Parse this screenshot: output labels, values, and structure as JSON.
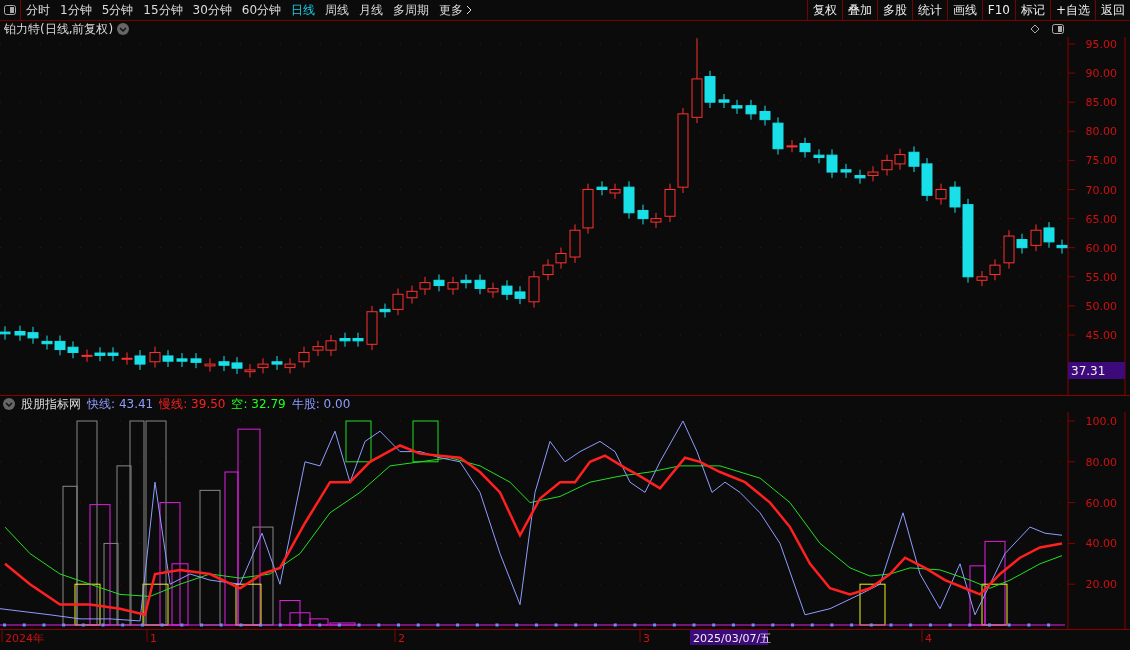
{
  "toolbar": {
    "periods": [
      {
        "label": "分时",
        "selected": false
      },
      {
        "label": "1分钟",
        "selected": false
      },
      {
        "label": "5分钟",
        "selected": false
      },
      {
        "label": "15分钟",
        "selected": false
      },
      {
        "label": "30分钟",
        "selected": false
      },
      {
        "label": "60分钟",
        "selected": false
      },
      {
        "label": "日线",
        "selected": true
      },
      {
        "label": "周线",
        "selected": false
      },
      {
        "label": "月线",
        "selected": false
      },
      {
        "label": "多周期",
        "selected": false
      },
      {
        "label": "更多",
        "selected": false
      }
    ],
    "actions": [
      "复权",
      "叠加",
      "多股",
      "统计",
      "画线",
      "F10",
      "标记",
      "+自选",
      "返回"
    ]
  },
  "main_chart": {
    "title": "铂力特(日线,前复权)",
    "price_ticks": [
      "95.00",
      "90.00",
      "85.00",
      "80.00",
      "75.00",
      "70.00",
      "65.00",
      "60.00",
      "55.00",
      "50.00",
      "45.00"
    ],
    "current_price": "37.31"
  },
  "indicator": {
    "name": "股朋指标网",
    "values": [
      {
        "label": "快线:",
        "value": "43.41",
        "color": "#8f9cff"
      },
      {
        "label": "慢线:",
        "value": "39.50",
        "color": "#ff2020"
      },
      {
        "label": "空:",
        "value": "32.79",
        "color": "#20ff20"
      },
      {
        "label": "牛股:",
        "value": "0.00",
        "color": "#8f9cff"
      }
    ],
    "ticks": [
      "100.0",
      "80.00",
      "60.00",
      "40.00",
      "20.00"
    ]
  },
  "date_axis": {
    "labels": [
      "2024年",
      "1",
      "2",
      "3",
      "4"
    ],
    "cursor_date": "2025/03/07/五"
  }
}
